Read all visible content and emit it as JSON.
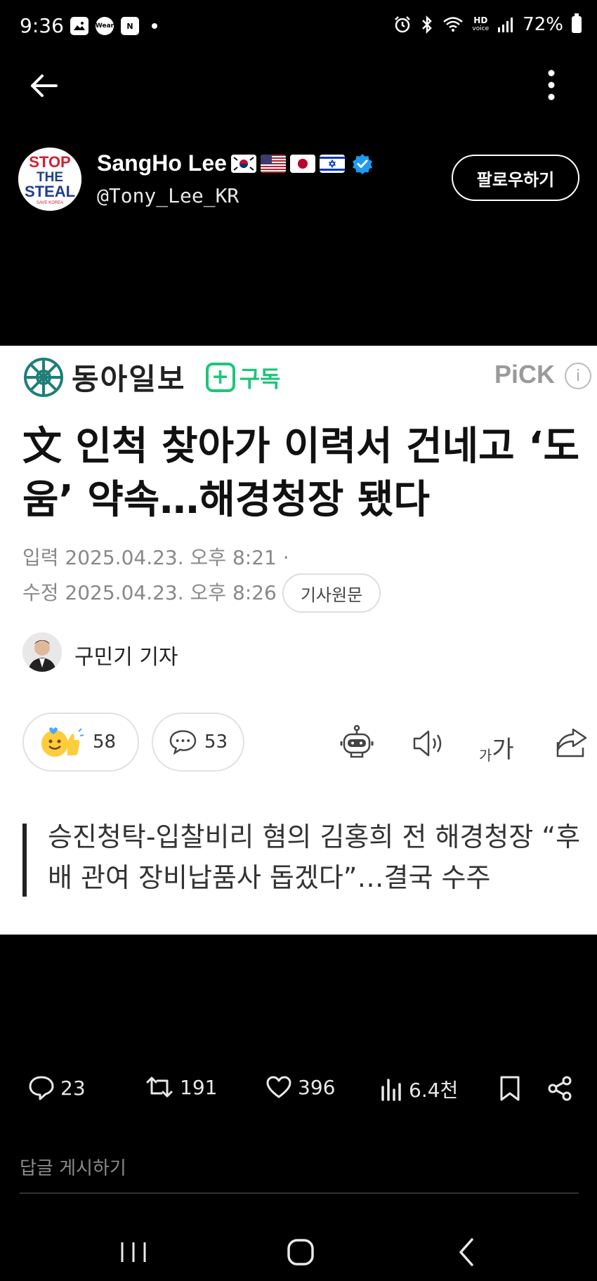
{
  "status_bar": {
    "time": "9:36",
    "left_icons": [
      "gallery-icon",
      "wear-icon",
      "naver-icon"
    ],
    "wear_label": "Wear",
    "naver_label": "N",
    "hd_top": "HD",
    "hd_bottom": "voice",
    "battery": "72%"
  },
  "tweet": {
    "display_name": "SangHo Lee",
    "flags": [
      "kr-flag",
      "us-flag",
      "jp-flag",
      "il-flag"
    ],
    "verified": true,
    "handle": "@Tony_Lee_KR",
    "follow_label": "팔로우하기",
    "avatar_text": [
      "STOP",
      "THE",
      "STEAL",
      "SAVE KOREA"
    ]
  },
  "article": {
    "logo_text": "동아일보",
    "subscribe_plus": "+",
    "subscribe_label": "구독",
    "pick_label": "PiCK",
    "info_label": "i",
    "headline": "文 인척 찾아가 이력서 건네고 ‘도움’ 약속…해경청장 됐다",
    "date_input": "입력 2025.04.23. 오후 8:21 ·",
    "date_modified": "수정 2025.04.23. 오후 8:26",
    "original_button": "기사원문",
    "reporter": "구민기 기자",
    "reaction_count": "58",
    "comment_count": "53",
    "font_size_label_small": "가",
    "font_size_label_large": "가",
    "quote": "승진청탁-입찰비리 혐의 김홍희 전 해경청장 “후배 관여 장비납품사 돕겠다”…결국 수주"
  },
  "actions": {
    "replies": "23",
    "retweets": "191",
    "likes": "396",
    "views": "6.4천"
  },
  "reply_placeholder": "답글 게시하기",
  "colors": {
    "background": "#000000",
    "article_background": "#ffffff",
    "subscribe_green": "#1cc67b",
    "logo_teal": "#1d7f78",
    "verified_blue": "#1d9bf0"
  }
}
